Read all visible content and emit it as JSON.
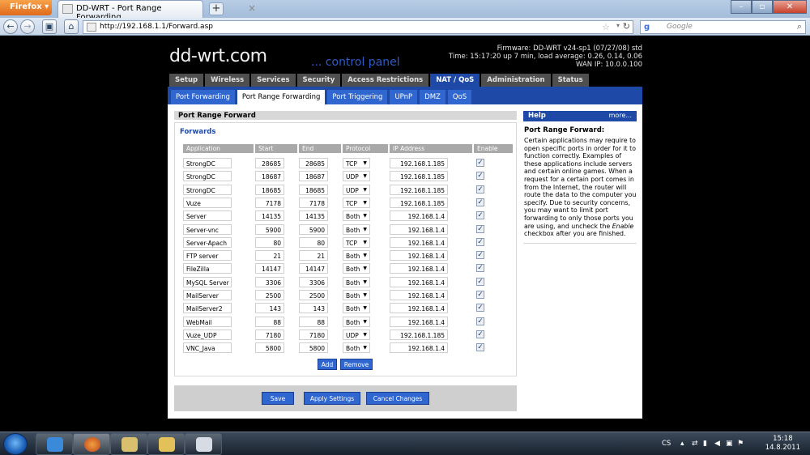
{
  "browser": {
    "app_button": "Firefox ▾",
    "tab_title": "DD-WRT - Port Range Forwarding",
    "url": "http://192.168.1.1/Forward.asp",
    "search_placeholder": "Google"
  },
  "header": {
    "logo": "dd-wrt.com",
    "logo_sub": "... control panel",
    "firmware": "Firmware: DD-WRT v24-sp1 (07/27/08) std",
    "time": "Time: 15:17:20 up 7 min, load average: 0.26, 0.14, 0.06",
    "wan_ip": "WAN IP: 10.0.0.100"
  },
  "main_tabs": [
    "Setup",
    "Wireless",
    "Services",
    "Security",
    "Access Restrictions",
    "NAT / QoS",
    "Administration",
    "Status"
  ],
  "active_main_tab": "NAT / QoS",
  "sub_tabs": [
    "Port Forwarding",
    "Port Range Forwarding",
    "Port Triggering",
    "UPnP",
    "DMZ",
    "QoS"
  ],
  "active_sub_tab": "Port Range Forwarding",
  "section_title": "Port Range Forward",
  "legend": "Forwards",
  "columns": [
    "Application",
    "Start",
    "End",
    "Protocol",
    "IP Address",
    "Enable"
  ],
  "rows": [
    {
      "app": "StrongDC",
      "start": "28685",
      "end": "28685",
      "protocol": "TCP",
      "ip": "192.168.1.185",
      "enabled": true
    },
    {
      "app": "StrongDC",
      "start": "18687",
      "end": "18687",
      "protocol": "UDP",
      "ip": "192.168.1.185",
      "enabled": true
    },
    {
      "app": "StrongDC",
      "start": "18685",
      "end": "18685",
      "protocol": "UDP",
      "ip": "192.168.1.185",
      "enabled": true
    },
    {
      "app": "Vuze",
      "start": "7178",
      "end": "7178",
      "protocol": "TCP",
      "ip": "192.168.1.185",
      "enabled": true
    },
    {
      "app": "Server",
      "start": "14135",
      "end": "14135",
      "protocol": "Both",
      "ip": "192.168.1.4",
      "enabled": true
    },
    {
      "app": "Server-vnc",
      "start": "5900",
      "end": "5900",
      "protocol": "Both",
      "ip": "192.168.1.4",
      "enabled": true
    },
    {
      "app": "Server-Apach",
      "start": "80",
      "end": "80",
      "protocol": "TCP",
      "ip": "192.168.1.4",
      "enabled": true
    },
    {
      "app": "FTP server",
      "start": "21",
      "end": "21",
      "protocol": "Both",
      "ip": "192.168.1.4",
      "enabled": true
    },
    {
      "app": "FileZilla",
      "start": "14147",
      "end": "14147",
      "protocol": "Both",
      "ip": "192.168.1.4",
      "enabled": true
    },
    {
      "app": "MySQL Server",
      "start": "3306",
      "end": "3306",
      "protocol": "Both",
      "ip": "192.168.1.4",
      "enabled": true
    },
    {
      "app": "MailServer",
      "start": "2500",
      "end": "2500",
      "protocol": "Both",
      "ip": "192.168.1.4",
      "enabled": true
    },
    {
      "app": "MailServer2",
      "start": "143",
      "end": "143",
      "protocol": "Both",
      "ip": "192.168.1.4",
      "enabled": true
    },
    {
      "app": "WebMail",
      "start": "88",
      "end": "88",
      "protocol": "Both",
      "ip": "192.168.1.4",
      "enabled": true
    },
    {
      "app": "Vuze_UDP",
      "start": "7180",
      "end": "7180",
      "protocol": "UDP",
      "ip": "192.168.1.185",
      "enabled": true
    },
    {
      "app": "VNC_Java",
      "start": "5800",
      "end": "5800",
      "protocol": "Both",
      "ip": "192.168.1.4",
      "enabled": true
    }
  ],
  "buttons": {
    "add": "Add",
    "remove": "Remove",
    "save": "Save",
    "apply": "Apply Settings",
    "cancel": "Cancel Changes"
  },
  "help": {
    "header": "Help",
    "more": "more...",
    "title": "Port Range Forward:",
    "text_before": "Certain applications may require to open specific ports in order for it to function correctly. Examples of these applications include servers and certain online games. When a request for a certain port comes in from the Internet, the router will route the data to the computer you specify. Due to security concerns, you may want to limit port forwarding to only those ports you are using, and uncheck the ",
    "text_em": "Enable",
    "text_after": " checkbox after you are finished."
  },
  "taskbar": {
    "lang": "CS",
    "time": "15:18",
    "date": "14.8.2011"
  },
  "colors": {
    "accent": "#1e49a6",
    "tab_bg": "#2f66d0",
    "section_bg": "#d8d8d8"
  }
}
